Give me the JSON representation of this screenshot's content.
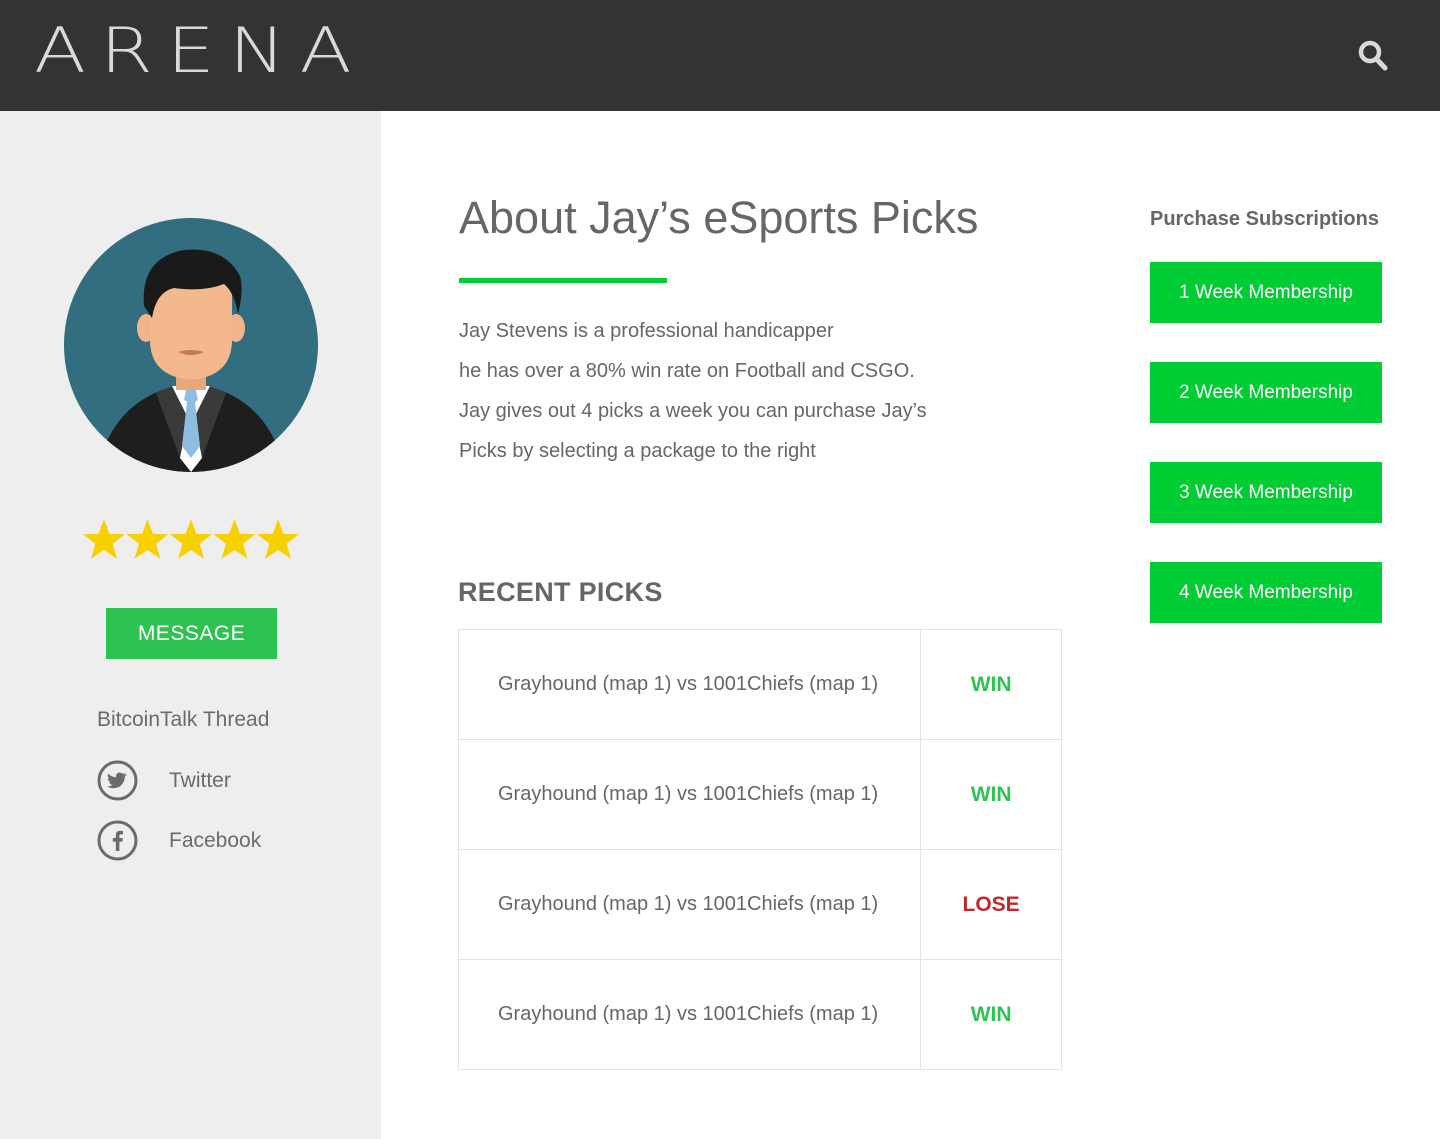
{
  "header": {
    "logo_text": "ARENA",
    "search_icon": "search-icon"
  },
  "sidebar": {
    "rating_stars": 5,
    "rating_max": 5,
    "message_label": "MESSAGE",
    "thread_label": "BitcoinTalk Thread",
    "social": [
      {
        "label": "Twitter",
        "icon": "twitter-icon"
      },
      {
        "label": "Facebook",
        "icon": "facebook-icon"
      }
    ]
  },
  "main": {
    "title": "About Jay’s eSports Picks",
    "about_lines": [
      "Jay Stevens is a professional handicapper",
      "he has over a 80% win rate on Football and  CSGO.",
      "Jay gives out 4 picks a week you can purchase Jay’s",
      "Picks by selecting a package to the right"
    ],
    "recent_title": "RECENT PICKS",
    "picks": [
      {
        "match": "Grayhound (map 1) vs 1001Chiefs (map 1)",
        "result": "WIN"
      },
      {
        "match": "Grayhound (map 1) vs 1001Chiefs (map 1)",
        "result": "WIN"
      },
      {
        "match": "Grayhound (map 1) vs 1001Chiefs (map 1)",
        "result": "LOSE"
      },
      {
        "match": "Grayhound (map 1) vs 1001Chiefs (map 1)",
        "result": "WIN"
      }
    ]
  },
  "subscriptions": {
    "title": "Purchase Subscriptions",
    "options": [
      {
        "label": "1 Week Membership"
      },
      {
        "label": "2 Week Membership"
      },
      {
        "label": "3 Week Membership"
      },
      {
        "label": "4 Week Membership"
      }
    ]
  },
  "colors": {
    "header_bg": "#333333",
    "sidebar_bg": "#eeeeee",
    "accent_green": "#00cc33",
    "message_green": "#2dc351",
    "win_green": "#2dc351",
    "lose_red": "#c0282d",
    "star_yellow": "#f8d000",
    "avatar_bg": "#326e80"
  }
}
